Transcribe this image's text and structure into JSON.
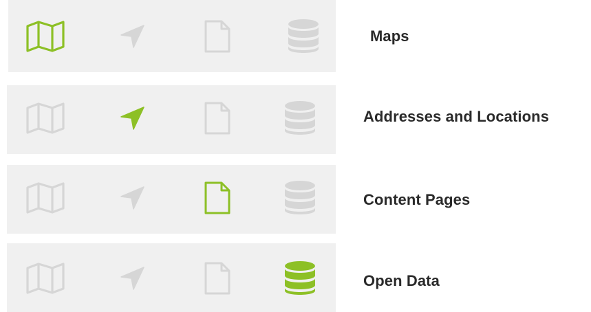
{
  "colors": {
    "active": "#8dc026",
    "inactive": "#d6d6d6",
    "panel": "#f0f0f0",
    "label": "#2a2a2a"
  },
  "icons": [
    "map-icon",
    "location-arrow-icon",
    "page-icon",
    "database-icon"
  ],
  "rows": [
    {
      "label": "Maps",
      "active_icon": "map-icon"
    },
    {
      "label": "Addresses and Locations",
      "active_icon": "location-arrow-icon"
    },
    {
      "label": "Content Pages",
      "active_icon": "page-icon"
    },
    {
      "label": "Open Data",
      "active_icon": "database-icon"
    }
  ]
}
